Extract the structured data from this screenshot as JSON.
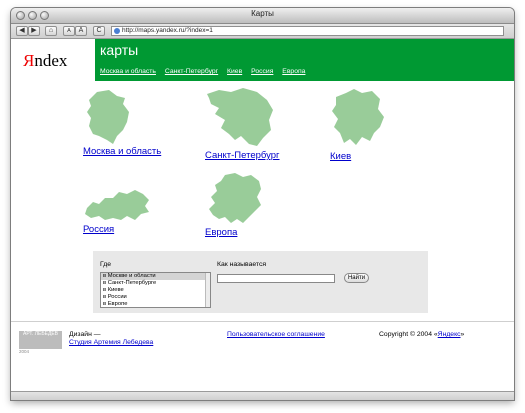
{
  "window": {
    "title": "Карты"
  },
  "toolbar": {
    "back_label": "◀",
    "forward_label": "▶",
    "home_label": "⌂",
    "font_small_label": "A",
    "font_big_label": "A",
    "reload_label": "C",
    "url": "http://maps.yandex.ru/?index=1"
  },
  "header": {
    "logo_first_letter": "Я",
    "logo_rest": "ndex",
    "section_title": "карты",
    "links": [
      "Москва и область",
      "Санкт-Петербург",
      "Киев",
      "Россия",
      "Европа"
    ]
  },
  "regions": [
    {
      "label": "Москва и область"
    },
    {
      "label": "Санкт-Петербург"
    },
    {
      "label": "Киев"
    },
    {
      "label": "Россия"
    },
    {
      "label": "Европа"
    }
  ],
  "search": {
    "where_label": "Где",
    "name_label": "Как называется",
    "options": [
      "в Москве и области",
      "в Санкт-Петербурге",
      "в Киеве",
      "в России",
      "в Европе"
    ],
    "selected_index": 0,
    "query": "",
    "find_label": "Найти"
  },
  "footer": {
    "stamp": "АРТ. ЛЕБЕДЕВ",
    "stamp_year": "2004",
    "design_text": "Дизайн —",
    "design_link": "Студия Артемия Лебедева",
    "agreement": "Пользовательское соглашение",
    "copyright_text": "Copyright © 2004 «",
    "copyright_link": "Яндекс",
    "copyright_end": "»"
  },
  "colors": {
    "brand_green": "#009933",
    "map_green": "#99cc99",
    "link_blue": "#0000cc",
    "logo_red": "#ee0000"
  }
}
